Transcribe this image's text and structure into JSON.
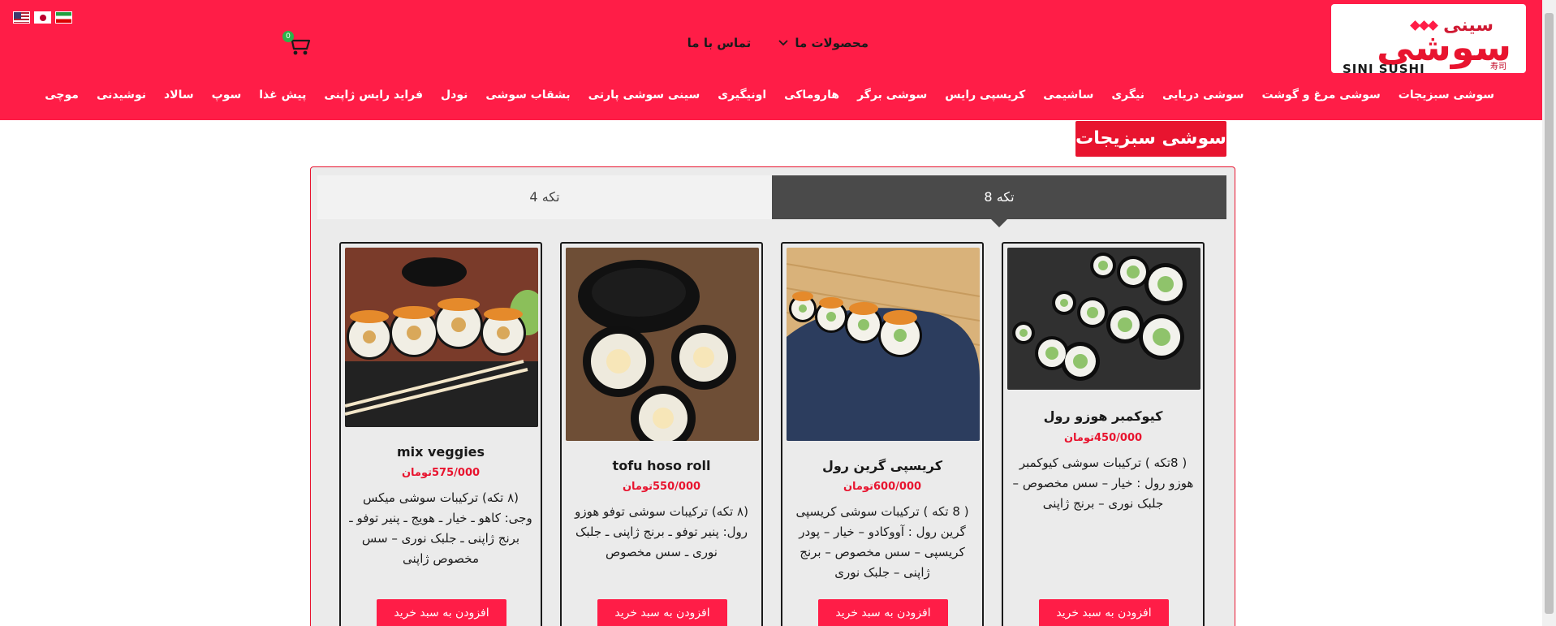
{
  "header": {
    "logo": {
      "top_text": "سینی",
      "main_text": "سوشی",
      "bottom_text": "SINI SUSHI",
      "kanji": "寿司"
    },
    "flags": [
      "us-flag",
      "japan-flag",
      "iran-flag"
    ],
    "cart_count": "0",
    "topnav": {
      "products": "محصولات ما",
      "contact": "تماس با ما"
    },
    "categories": [
      "سوشی سبزیجات",
      "سوشی مرغ و گوشت",
      "سوشی دریایی",
      "نیگری",
      "ساشیمی",
      "کریسپی رایس",
      "سوشی برگر",
      "هاروماکی",
      "اونیگیری",
      "سینی سوشی پارتی",
      "بشقاب سوشی",
      "نودل",
      "فراید رایس ژاپنی",
      "پیش غذا",
      "سوپ",
      "سالاد",
      "نوشیدنی",
      "موچی"
    ]
  },
  "section": {
    "title": "سوشی سبزیجات",
    "tabs": {
      "active": "8 تکه",
      "inactive": "4 تکه"
    }
  },
  "products": [
    {
      "name": "کیوکمبر هوزو رول",
      "price": "450/000تومان",
      "description": "( 8تکه ) ترکیبات سوشی کیوکمبر هوزو رول : خیار – سس مخصوص – جلبک نوری – برنج ژاپنی",
      "button": "افزودن به سبد خرید"
    },
    {
      "name": "کریسپی گرین رول",
      "price": "600/000تومان",
      "description": "( 8 تکه ) ترکیبات سوشی کریسپی گرین رول : آووکادو – خیار – پودر کریسپی – سس مخصوص – برنج ژاپنی – جلبک نوری",
      "button": "افزودن به سبد خرید"
    },
    {
      "name": "tofu hoso roll",
      "price": "550/000تومان",
      "description": "(۸ تکه) ترکیبات سوشی توفو هوزو رول: پنیر توفو ـ برنج ژاپنی ـ جلبک نوری ـ سس مخصوص",
      "button": "افزودن به سبد خرید"
    },
    {
      "name": "mix veggies",
      "price": "575/000تومان",
      "description": "(۸ تکه) ترکیبات سوشی میکس وجی: کاهو ـ خیار ـ هویج ـ پنیر توفو ـ برنج ژاپنی ـ جلبک نوری – سس مخصوص ژاپنی",
      "button": "افزودن به سبد خرید"
    }
  ],
  "colors": {
    "brand_red": "#ff1d47",
    "price_red": "#e8142f",
    "tab_active": "#4a4a4a",
    "cart_badge": "#2db34a"
  }
}
